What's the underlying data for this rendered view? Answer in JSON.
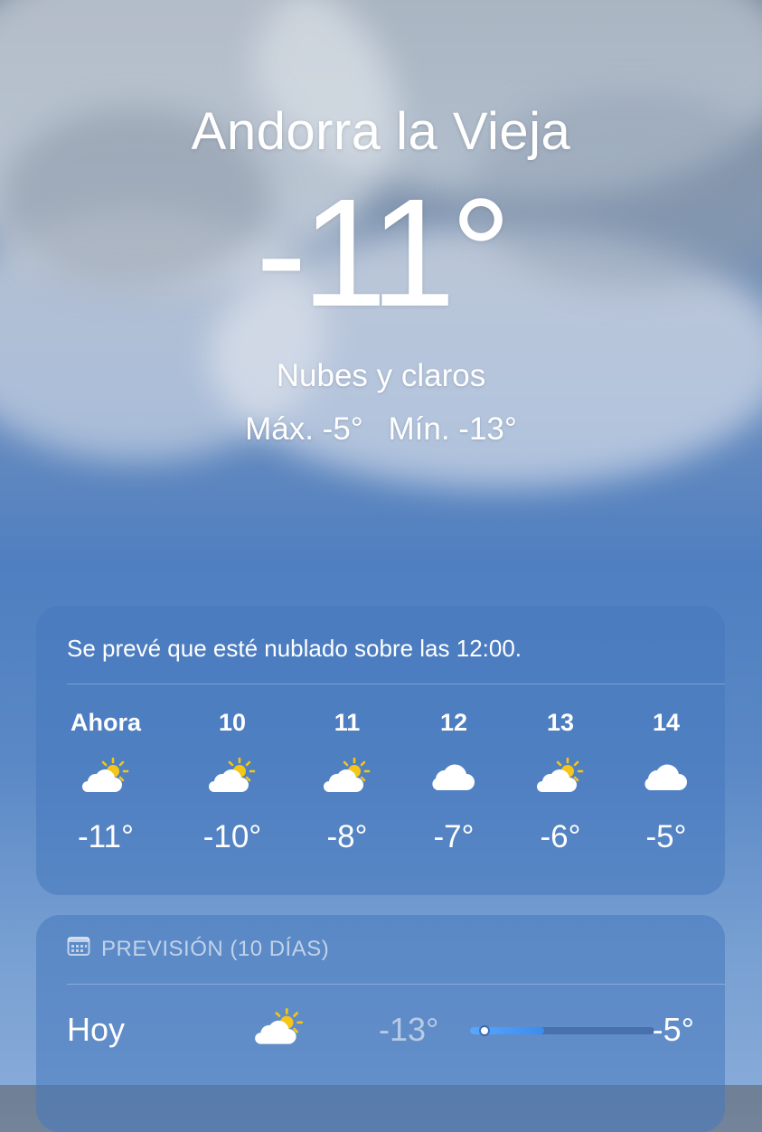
{
  "location": {
    "city": "Andorra la Vieja"
  },
  "current": {
    "temperature": "-11°",
    "condition": "Nubes y claros",
    "high": "Máx. -5°",
    "low": "Mín. -13°"
  },
  "hourly": {
    "summary": "Se prevé que esté nublado sobre las 12:00.",
    "items": [
      {
        "label": "Ahora",
        "icon": "partly-sunny-icon",
        "temp": "-11°"
      },
      {
        "label": "10",
        "icon": "partly-sunny-icon",
        "temp": "-10°"
      },
      {
        "label": "11",
        "icon": "partly-sunny-icon",
        "temp": "-8°"
      },
      {
        "label": "12",
        "icon": "cloud-icon",
        "temp": "-7°"
      },
      {
        "label": "13",
        "icon": "partly-sunny-icon",
        "temp": "-6°"
      },
      {
        "label": "14",
        "icon": "cloud-icon",
        "temp": "-5°"
      }
    ]
  },
  "daily": {
    "header": "PREVISIÓN (10 DÍAS)",
    "days": [
      {
        "day": "Hoy",
        "icon": "partly-sunny-icon",
        "low": "-13°",
        "high": "-5°",
        "bar_start": 0.0,
        "bar_end": 0.4,
        "current_marker": 0.08
      }
    ]
  },
  "colors": {
    "sun": "#f5c518",
    "bar": "#3b8cf0"
  }
}
